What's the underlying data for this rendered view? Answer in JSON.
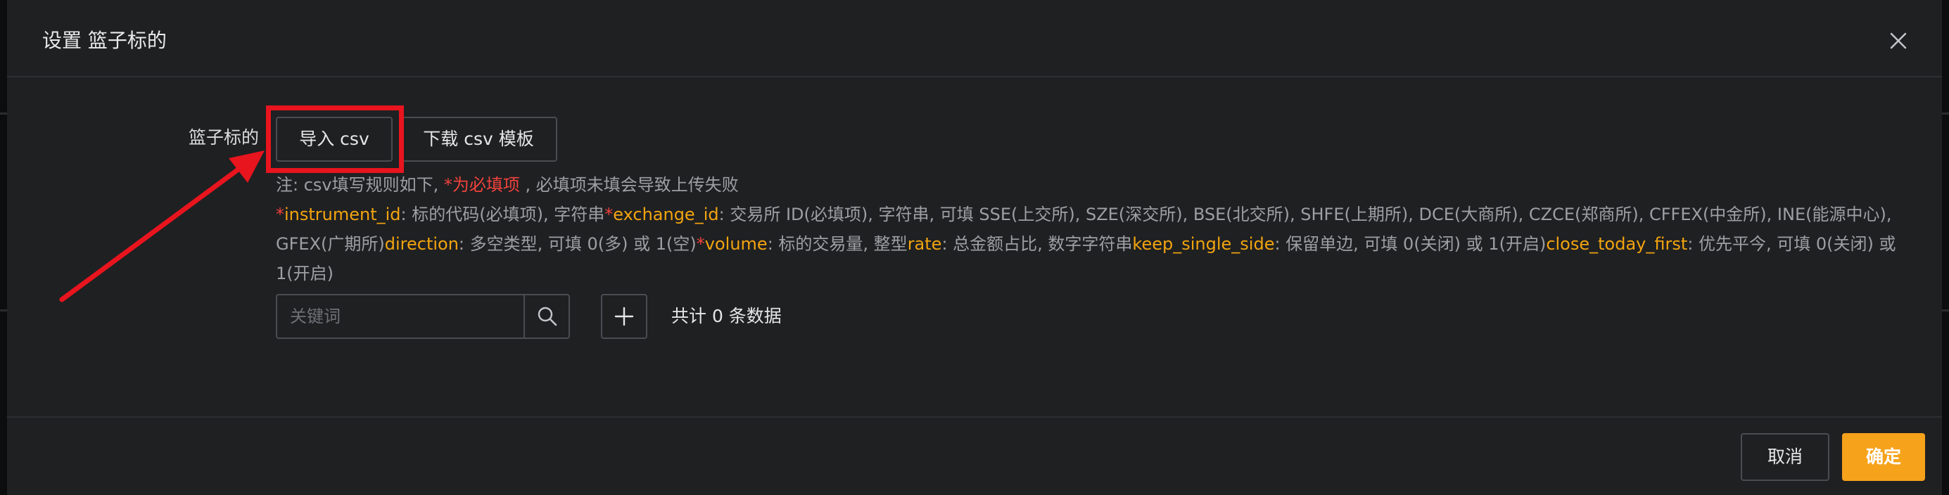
{
  "dialog": {
    "title": "设置 篮子标的",
    "close_icon": "close-icon"
  },
  "form": {
    "basket_label": "篮子标的",
    "import_button": "导入 csv",
    "download_button": "下载 csv 模板"
  },
  "note": {
    "prefix": "注: csv填写规则如下, ",
    "required_marker": "*为必填项",
    "suffix": " , 必填项未填会导致上传失败"
  },
  "fields": [
    {
      "star": "*",
      "name": "instrument_id",
      "desc": ": 标的代码(必填项), 字符串"
    },
    {
      "star": "*",
      "name": "exchange_id",
      "desc": ": 交易所 ID(必填项), 字符串, 可填 SSE(上交所), SZE(深交所), BSE(北交所), SHFE(上期所), DCE(大商所), CZCE(郑商所), CFFEX(中金所), INE(能源中心), GFEX(广期所)"
    },
    {
      "star": "",
      "name": "direction",
      "desc": ": 多空类型, 可填 0(多) 或 1(空)"
    },
    {
      "star": "*",
      "name": "volume",
      "desc": ": 标的交易量, 整型"
    },
    {
      "star": "",
      "name": "rate",
      "desc": ": 总金额占比, 数字字符串"
    },
    {
      "star": "",
      "name": "keep_single_side",
      "desc": ": 保留单边, 可填 0(关闭) 或 1(开启)"
    },
    {
      "star": "",
      "name": "close_today_first",
      "desc": ": 优先平今, 可填 0(关闭) 或 1(开启)"
    }
  ],
  "search": {
    "placeholder": "关键词",
    "icon": "search-icon"
  },
  "add_icon": "plus-icon",
  "total_text": "共计 0 条数据",
  "footer": {
    "cancel": "取消",
    "confirm": "确定"
  },
  "colors": {
    "accent": "#f7a21b",
    "field": "#f2a40f",
    "required": "#f0423c",
    "annotation": "#e8141e"
  }
}
